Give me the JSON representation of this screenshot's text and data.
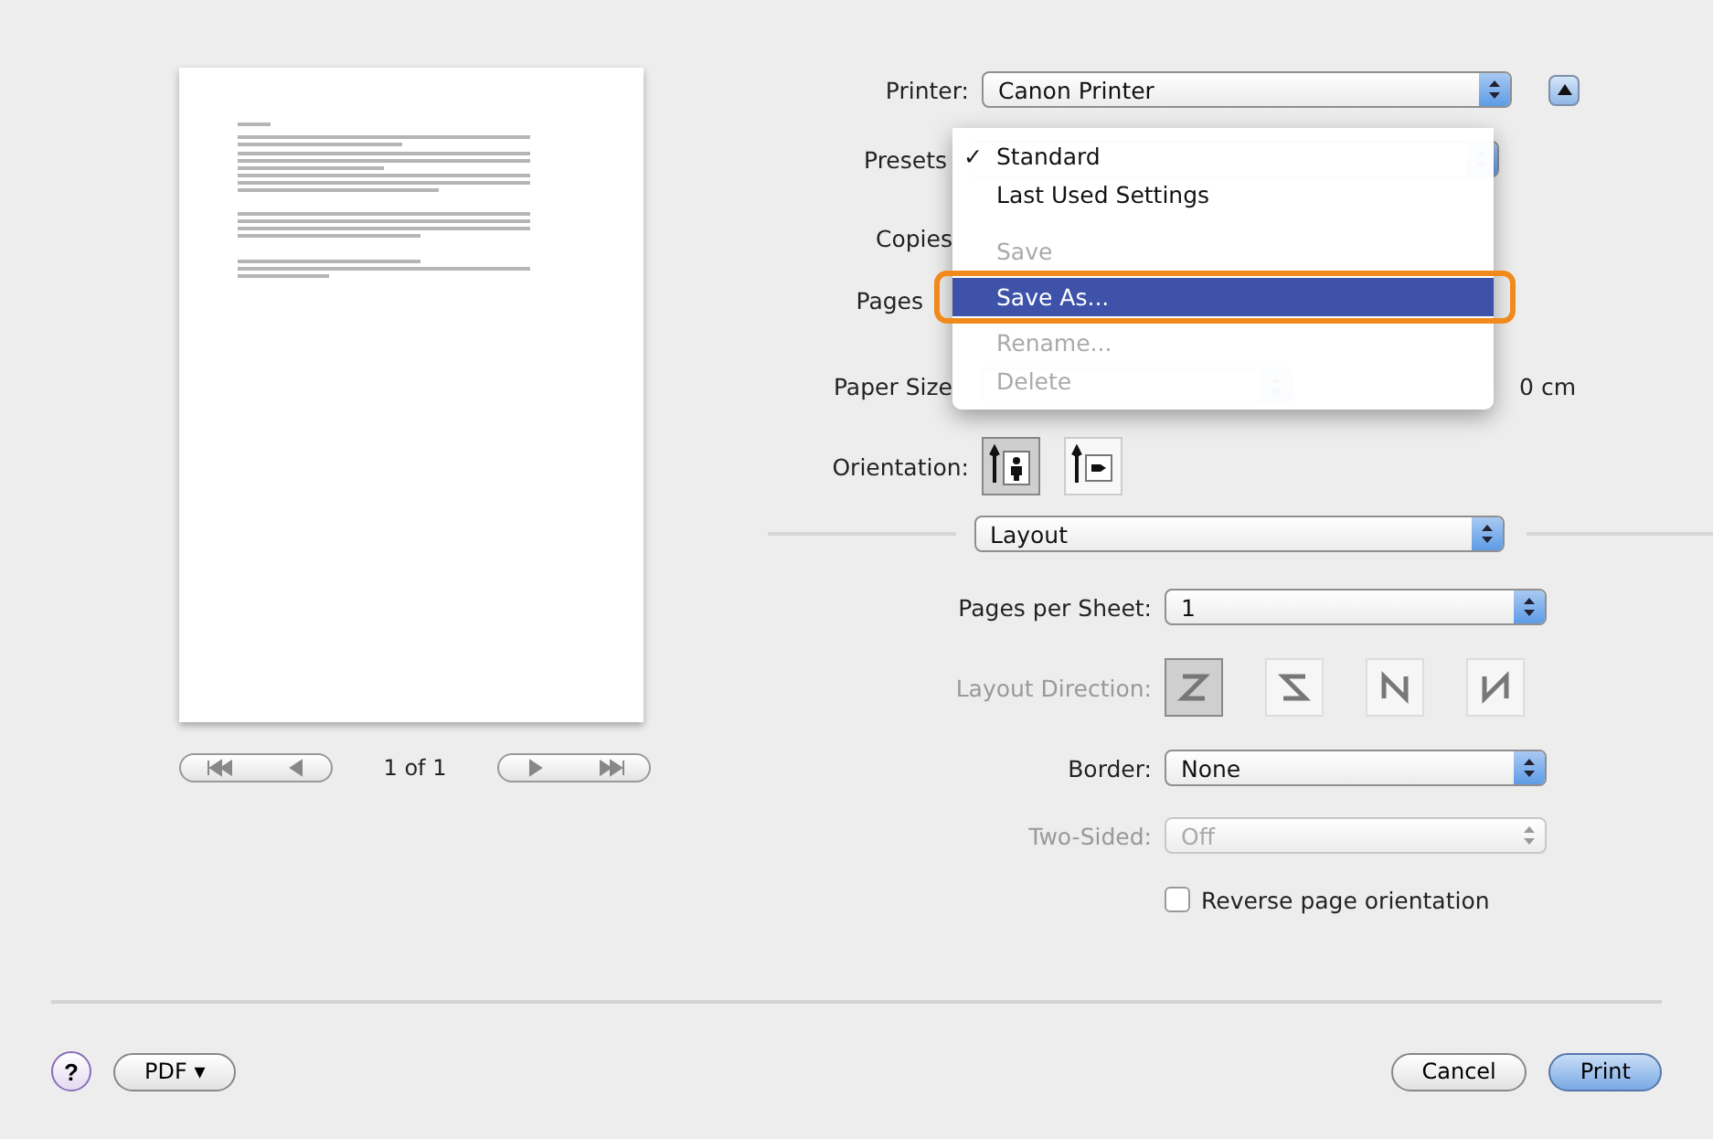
{
  "preview": {
    "page_label": "1 of 1"
  },
  "printer": {
    "label": "Printer:",
    "value": "Canon Printer"
  },
  "presets": {
    "label": "Presets"
  },
  "copies": {
    "label": "Copies"
  },
  "pages": {
    "label": "Pages"
  },
  "paper_size": {
    "label": "Paper Size",
    "readout": "0 cm"
  },
  "orientation": {
    "label": "Orientation:",
    "options": [
      {
        "kind": "portrait",
        "selected": true
      },
      {
        "kind": "landscape",
        "selected": false
      }
    ]
  },
  "section": {
    "value": "Layout"
  },
  "pages_per_sheet": {
    "label": "Pages per Sheet:",
    "value": "1"
  },
  "layout_direction": {
    "label": "Layout Direction:",
    "disabled": true,
    "options": [
      {
        "kind": "z",
        "selected": true
      },
      {
        "kind": "s",
        "selected": false
      },
      {
        "kind": "n",
        "selected": false
      },
      {
        "kind": "n-reverse",
        "selected": false
      }
    ]
  },
  "border": {
    "label": "Border:",
    "value": "None"
  },
  "two_sided": {
    "label": "Two-Sided:",
    "value": "Off",
    "disabled": true
  },
  "reverse": {
    "label": "Reverse page orientation",
    "checked": false
  },
  "presets_menu": {
    "check_mark": "✓",
    "items": [
      {
        "kind": "item",
        "label": "Standard",
        "checked": true,
        "disabled": false,
        "selected": false
      },
      {
        "kind": "item",
        "label": "Last Used Settings",
        "checked": false,
        "disabled": false,
        "selected": false
      },
      {
        "kind": "separator"
      },
      {
        "kind": "item",
        "label": "Save",
        "checked": false,
        "disabled": true,
        "selected": false
      },
      {
        "kind": "item",
        "label": "Save As...",
        "checked": false,
        "disabled": false,
        "selected": true
      },
      {
        "kind": "item",
        "label": "Rename...",
        "checked": false,
        "disabled": true,
        "selected": false
      },
      {
        "kind": "item",
        "label": "Delete",
        "checked": false,
        "disabled": true,
        "selected": false
      }
    ]
  },
  "footer": {
    "help": "?",
    "pdf": "PDF ▾",
    "cancel": "Cancel",
    "print": "Print"
  }
}
